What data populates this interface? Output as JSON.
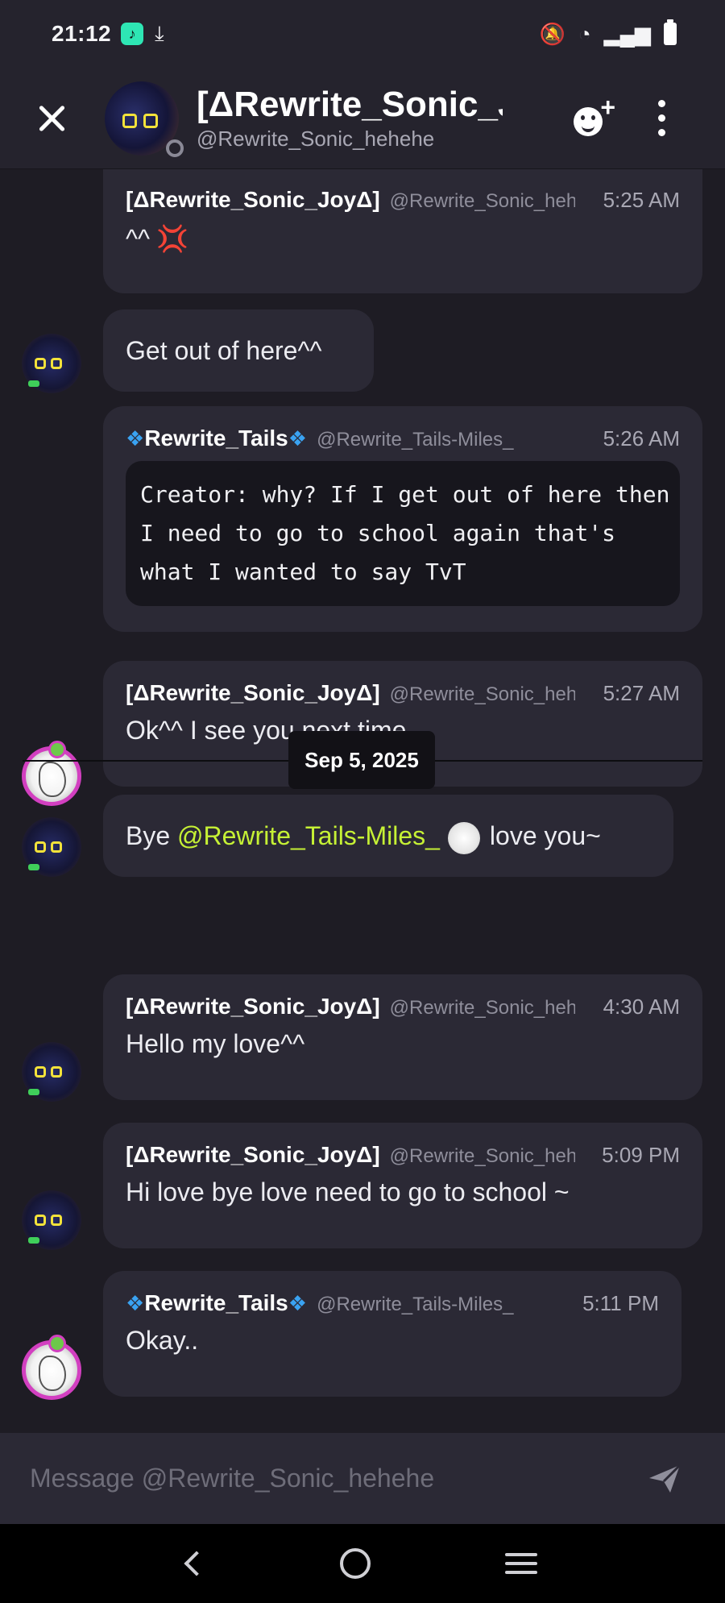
{
  "status_bar": {
    "time": "21:12"
  },
  "header": {
    "name": "[ΔRewrite_Sonic_JoyΔ]",
    "handle": "@Rewrite_Sonic_hehehe"
  },
  "messages": [
    {
      "author": "[ΔRewrite_Sonic_JoyΔ]",
      "handle": "@Rewrite_Sonic_hehehe",
      "time": "5:25 AM",
      "text": "^^"
    },
    {
      "text": "Get out of here^^"
    },
    {
      "author": "Rewrite_Tails",
      "handle": "@Rewrite_Tails-Miles_",
      "time": "5:26 AM",
      "code": "Creator: why? If I get out of here then\nI need to go to school again that's\nwhat I wanted to say TvT"
    },
    {
      "author": "[ΔRewrite_Sonic_JoyΔ]",
      "handle": "@Rewrite_Sonic_hehehe",
      "time": "5:27 AM",
      "text": "Ok^^ I see you next time"
    },
    {
      "text_before": "Bye",
      "mention": "@Rewrite_Tails-Miles_",
      "text_after": "love you~"
    },
    {
      "author": "[ΔRewrite_Sonic_JoyΔ]",
      "handle": "@Rewrite_Sonic_hehehe",
      "time": "4:30 AM",
      "text": "Hello my love^^"
    },
    {
      "author": "[ΔRewrite_Sonic_JoyΔ]",
      "handle": "@Rewrite_Sonic_hehehe",
      "time": "5:09 PM",
      "text": "Hi love bye love need to go to school ~"
    },
    {
      "author": "Rewrite_Tails",
      "handle": "@Rewrite_Tails-Miles_",
      "time": "5:11 PM",
      "text": "Okay.."
    }
  ],
  "date_divider": "Sep 5, 2025",
  "composer": {
    "placeholder": "Message @Rewrite_Sonic_hehehe"
  },
  "colors": {
    "mention": "#c6f135",
    "background": "#1e1c24",
    "bubble": "#2b2935",
    "tails_ring": "#d23fc0"
  },
  "icons": [
    "close-icon",
    "add-friend-icon",
    "more-icon",
    "send-icon",
    "anger-icon",
    "diamond-icon",
    "nav-back-icon",
    "nav-home-icon",
    "nav-recent-icon"
  ]
}
